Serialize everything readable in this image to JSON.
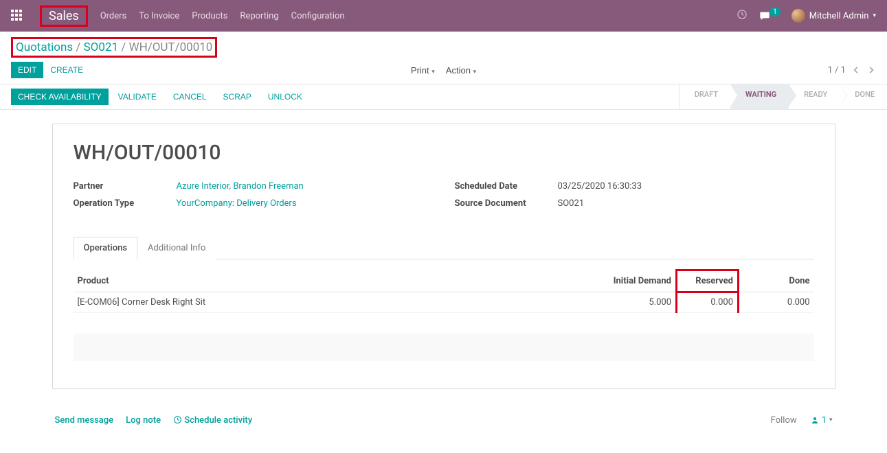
{
  "navbar": {
    "brand": "Sales",
    "links": [
      "Orders",
      "To Invoice",
      "Products",
      "Reporting",
      "Configuration"
    ],
    "chat_count": "1",
    "user": "Mitchell Admin"
  },
  "breadcrumb": {
    "parts": [
      "Quotations",
      "SO021",
      "WH/OUT/00010"
    ]
  },
  "buttons": {
    "edit": "EDIT",
    "create": "CREATE",
    "print": "Print",
    "action": "Action",
    "check_availability": "CHECK AVAILABILITY",
    "validate": "VALIDATE",
    "cancel": "CANCEL",
    "scrap": "SCRAP",
    "unlock": "UNLOCK"
  },
  "pager": {
    "text": "1 / 1"
  },
  "status": {
    "draft": "DRAFT",
    "waiting": "WAITING",
    "ready": "READY",
    "done": "DONE"
  },
  "record": {
    "title": "WH/OUT/00010",
    "partner_label": "Partner",
    "partner_value": "Azure Interior, Brandon Freeman",
    "operation_type_label": "Operation Type",
    "operation_type_value": "YourCompany: Delivery Orders",
    "scheduled_date_label": "Scheduled Date",
    "scheduled_date_value": "03/25/2020 16:30:33",
    "source_doc_label": "Source Document",
    "source_doc_value": "SO021"
  },
  "tabs": {
    "operations": "Operations",
    "additional_info": "Additional Info"
  },
  "table": {
    "headers": {
      "product": "Product",
      "initial_demand": "Initial Demand",
      "reserved": "Reserved",
      "done": "Done"
    },
    "row0": {
      "product": "[E-COM06] Corner Desk Right Sit",
      "initial_demand": "5.000",
      "reserved": "0.000",
      "done": "0.000"
    }
  },
  "chatter": {
    "send_message": "Send message",
    "log_note": "Log note",
    "schedule_activity": "Schedule activity",
    "follow": "Follow",
    "followers": "1"
  }
}
